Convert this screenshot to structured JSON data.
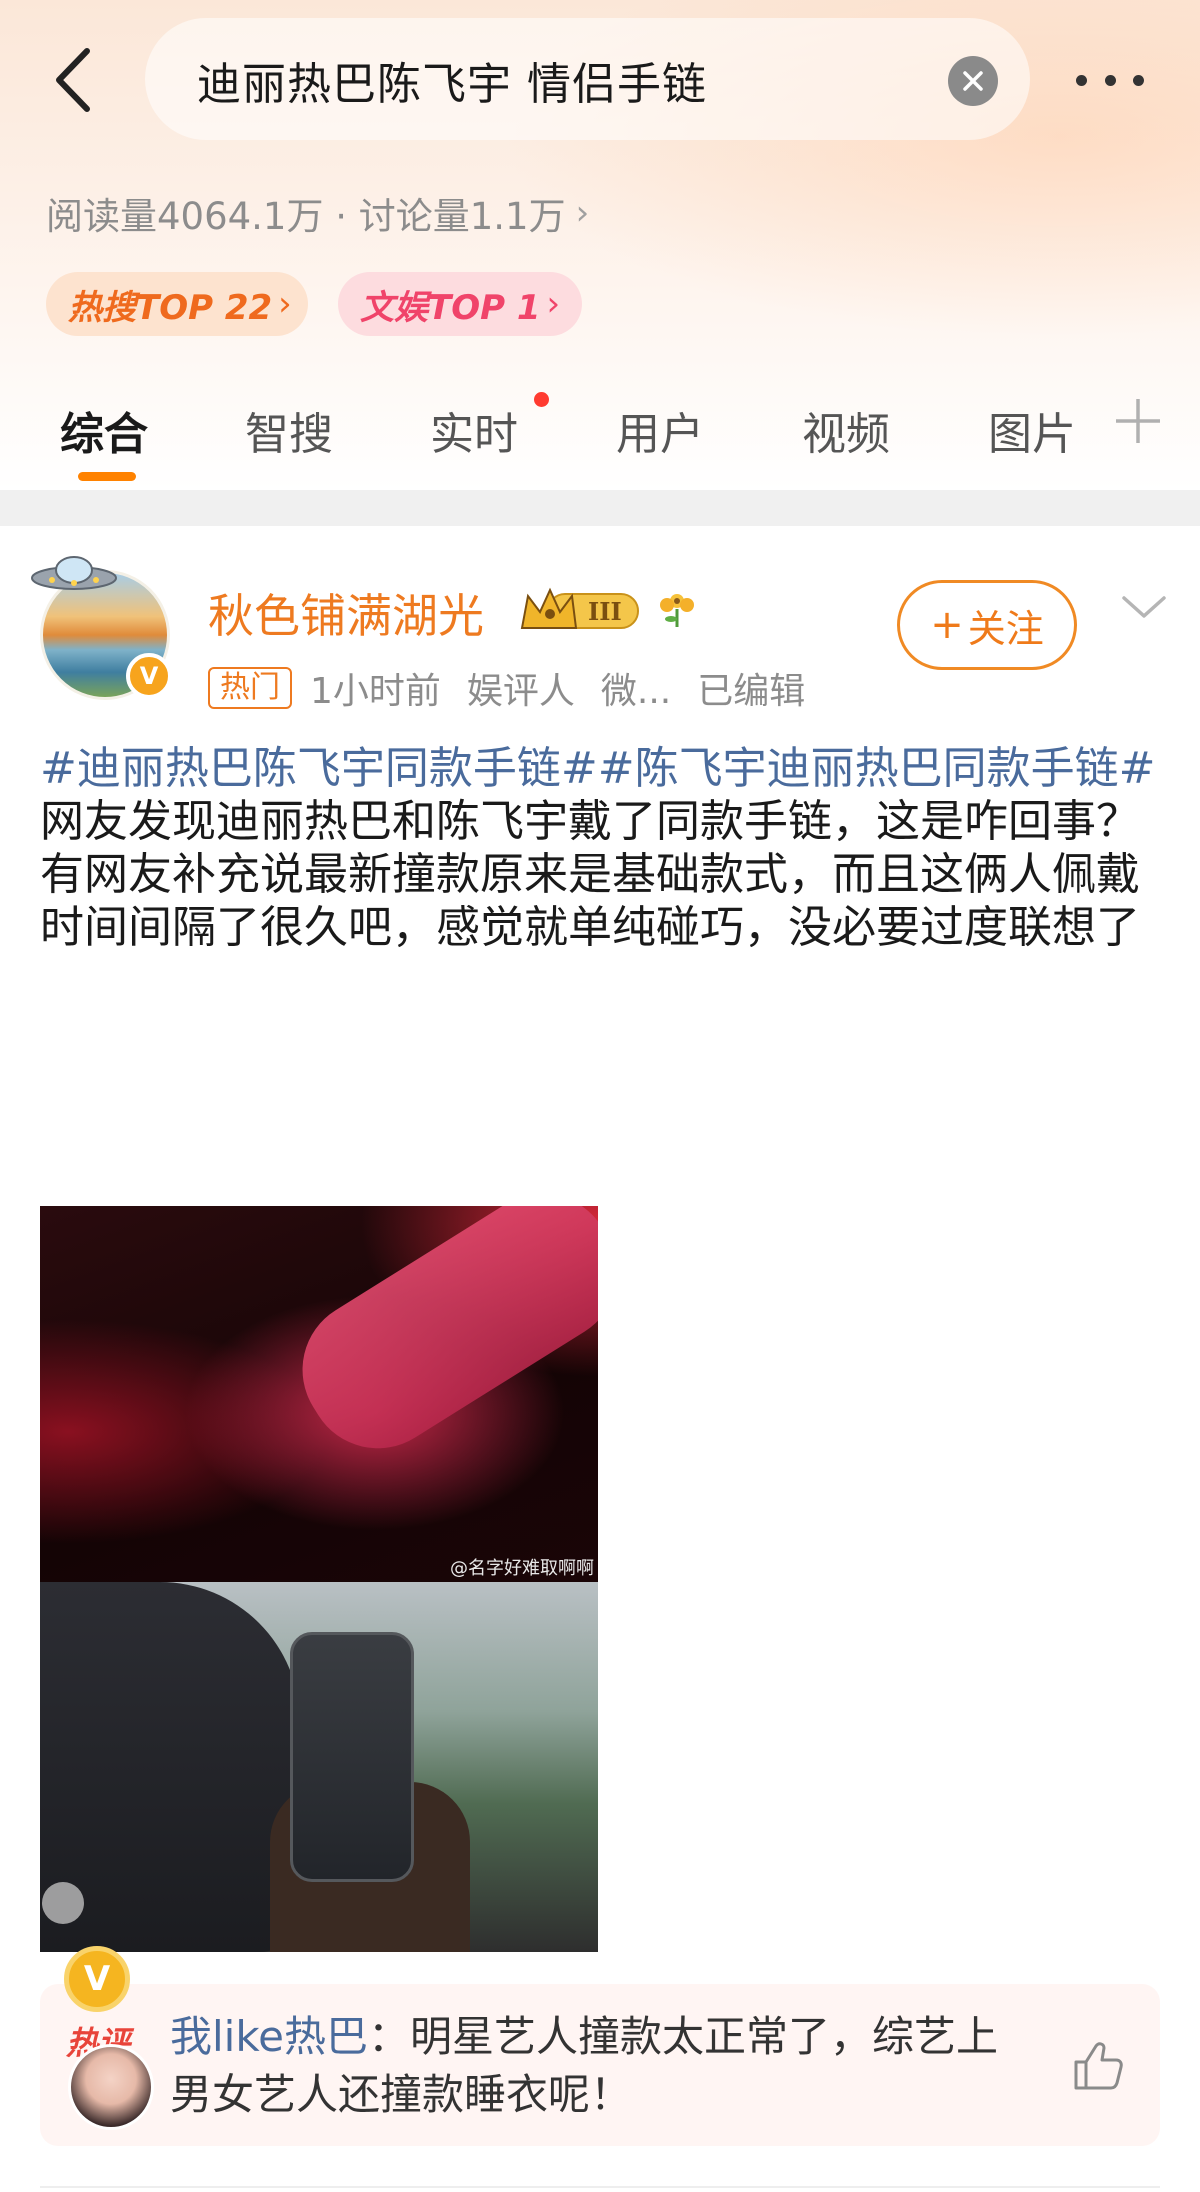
{
  "header": {
    "search_query": "迪丽热巴陈飞宇 情侣手链",
    "stats": "阅读量4064.1万 · 讨论量1.1万",
    "stats_arrow": "›",
    "badges": [
      {
        "label": "热搜TOP 22",
        "arrow": "›",
        "color": "#ef6a1e"
      },
      {
        "label": "文娱TOP 1",
        "arrow": "›",
        "color": "#f0446a"
      }
    ]
  },
  "tabs": [
    {
      "label": "综合",
      "active": true
    },
    {
      "label": "智搜"
    },
    {
      "label": "实时",
      "has_dot": true
    },
    {
      "label": "用户"
    },
    {
      "label": "视频"
    },
    {
      "label": "图片"
    }
  ],
  "post": {
    "username": "秋色铺满湖光",
    "level_badge": "III",
    "verified_mark": "V",
    "meta": {
      "hot_tag": "热门",
      "time": "1小时前",
      "role": "娱评人",
      "source": "微...",
      "edited": "已编辑"
    },
    "follow_label": "关注",
    "follow_plus": "+",
    "topics": "#迪丽热巴陈飞宇同款手链##陈飞宇迪丽热巴同款手链#",
    "body": "网友发现迪丽热巴和陈飞宇戴了同款手链，这是咋回事？ 有网友补充说最新撞款原来是基础款式，而且这俩人佩戴时间间隔了很久吧，感觉就单纯碰巧，没必要过度联想了",
    "image_watermark": "@名字好难取啊啊"
  },
  "hot_comment": {
    "label": "热评",
    "badge": "V",
    "user": "我like热巴",
    "separator": "：",
    "text": "明星艺人撞款太正常了，综艺上男女艺人还撞款睡衣呢！"
  },
  "colors": {
    "accent_orange": "#ff8200",
    "topic_blue": "#4a6b9c",
    "username_orange": "#ee7a20",
    "badge_red": "#f0446a"
  },
  "icons": [
    "back-arrow-icon",
    "clear-icon",
    "more-icon",
    "plus-icon",
    "ufo-icon",
    "crown-icon",
    "flower-icon",
    "chevron-down-icon",
    "thumbs-up-icon"
  ]
}
